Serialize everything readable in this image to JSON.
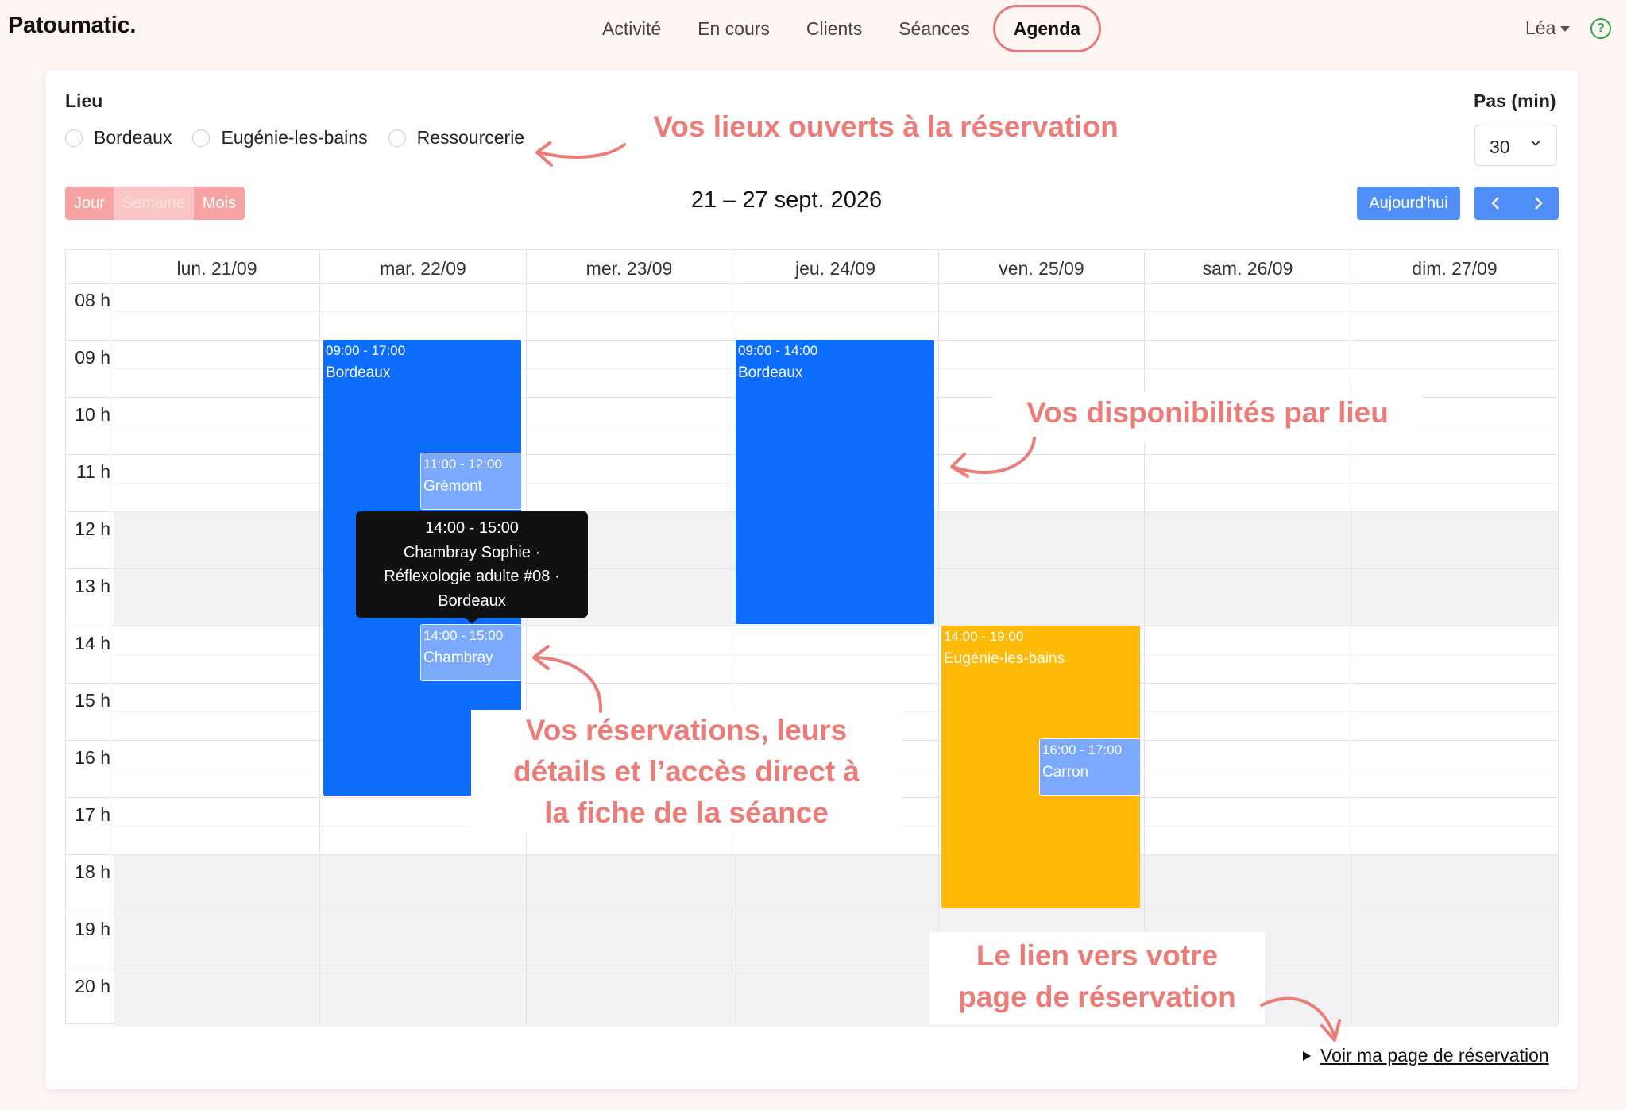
{
  "header": {
    "brand": "Patoumatic.",
    "nav": [
      "Activité",
      "En cours",
      "Clients",
      "Séances"
    ],
    "nav_active": "Agenda",
    "user": "Léa",
    "help_glyph": "?"
  },
  "filters": {
    "lieu_label": "Lieu",
    "places": [
      "Bordeaux",
      "Eugénie-les-bains",
      "Ressourcerie"
    ],
    "pas_label": "Pas (min)",
    "pas_value": "30"
  },
  "toolbar": {
    "views": [
      "Jour",
      "Semaine",
      "Mois"
    ],
    "range": "21 – 27 sept. 2026",
    "today": "Aujourd'hui",
    "prev_glyph": "‹",
    "next_glyph": "›"
  },
  "calendar": {
    "days": [
      "lun. 21/09",
      "mar. 22/09",
      "mer. 23/09",
      "jeu. 24/09",
      "ven. 25/09",
      "sam. 26/09",
      "dim. 27/09"
    ],
    "hours": [
      "08 h",
      "09 h",
      "10 h",
      "11 h",
      "12 h",
      "13 h",
      "14 h",
      "15 h",
      "16 h",
      "17 h",
      "18 h",
      "19 h",
      "20 h"
    ],
    "availabilities": [
      {
        "time": "09:00 - 17:00",
        "place": "Bordeaux"
      },
      {
        "time": "09:00 - 14:00",
        "place": "Bordeaux"
      },
      {
        "time": "14:00 - 19:00",
        "place": "Eugénie-les-bains"
      }
    ],
    "bookings": [
      {
        "time": "11:00 - 12:00",
        "name": "Grémont"
      },
      {
        "time": "14:00 - 15:00",
        "name": "Chambray"
      },
      {
        "time": "16:00 - 17:00",
        "name": "Carron"
      }
    ],
    "tooltip": [
      "14:00 - 15:00",
      "Chambray Sophie ·",
      "Réflexologie adulte #08 ·",
      "Bordeaux"
    ]
  },
  "annotations": {
    "places": "Vos lieux ouverts à la réservation",
    "availability": "Vos disponibilités par lieu",
    "bookings": [
      "Vos réservations, leurs",
      "détails et l’accès direct à",
      "la fiche de la séance"
    ],
    "link": [
      "Le lien vers votre",
      "page de réservation"
    ]
  },
  "footer": {
    "booking_link": "Voir ma page de réservation"
  },
  "colors": {
    "accent": "#e8797b",
    "availability_blue": "#0d6efd",
    "availability_yellow": "#ffba08",
    "booking_blue": "#7aa9fd",
    "view_buttons": "#f8a3a3",
    "nav_buttons": "#4f8ef7"
  }
}
